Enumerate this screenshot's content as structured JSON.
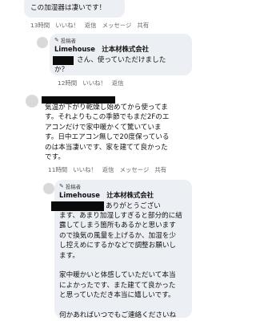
{
  "comment1": {
    "text": "この加湿器は凄いです！",
    "time": "13時間",
    "like": "いいね！",
    "reply": "返信",
    "message": "メッセージ",
    "share": "共有"
  },
  "reply1": {
    "badge": "投稿者",
    "author": "Limehouse　辻本材株式会社",
    "lines": [
      "さん、使っていただけました",
      "か？"
    ],
    "time": "12時間",
    "like": "いいね！",
    "reply": "返信"
  },
  "comment2": {
    "lines": [
      "気温が下がり乾燥し始めてから使ってま",
      "す。それよりもこの季節でもまだ2Fのエ",
      "アコンだけで家中暖かくて驚いていま",
      "す。日中エアコン無しで20度保っている",
      "のは本当凄いです、家を建てて良かった",
      "です。"
    ],
    "time": "11時間",
    "like": "いいね！",
    "reply": "返信",
    "message": "メッセージ",
    "share": "共有"
  },
  "reply2": {
    "badge": "投稿者",
    "author": "Limehouse　辻本材株式会社",
    "lines": [
      "ありがとうござい",
      "ます、あまり加湿しすぎると部分的に結",
      "露してしまう箇所もあるかと思います",
      "ので換気の風量を上げるか、加湿を少",
      "し控えめにするかなどで調整お願いし",
      "ます。",
      "",
      "家中暖かいと体感していただいて本当",
      "によかったです、また建てて良かった",
      "と思っていただき本当に嬉しいです。",
      "",
      "何かあればいつでもご連絡くださいね"
    ]
  }
}
